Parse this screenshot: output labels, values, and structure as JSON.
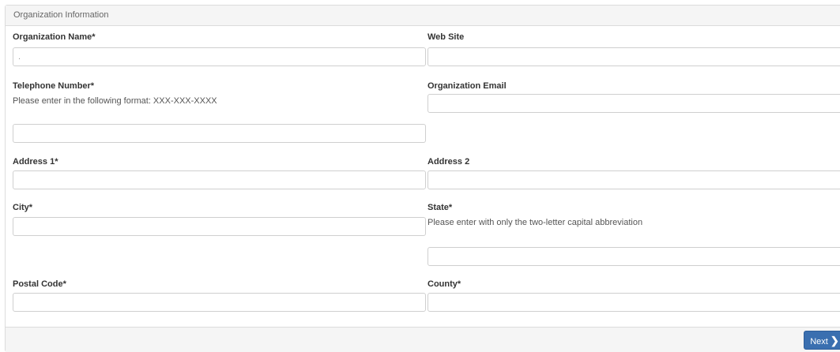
{
  "panel": {
    "title": "Organization Information"
  },
  "fields": {
    "org_name": {
      "label": "Organization Name*",
      "value": "."
    },
    "website": {
      "label": "Web Site",
      "value": ""
    },
    "telephone": {
      "label": "Telephone Number*",
      "help": "Please enter in the following format: XXX-XXX-XXXX",
      "value": ""
    },
    "org_email": {
      "label": "Organization Email",
      "value": ""
    },
    "address1": {
      "label": "Address 1*",
      "value": ""
    },
    "address2": {
      "label": "Address 2",
      "value": ""
    },
    "city": {
      "label": "City*",
      "value": ""
    },
    "state": {
      "label": "State*",
      "help": "Please enter with only the two-letter capital abbreviation",
      "value": ""
    },
    "postal_code": {
      "label": "Postal Code*",
      "value": ""
    },
    "county": {
      "label": "County*",
      "value": ""
    }
  },
  "footer": {
    "next_label": "Next",
    "next_icon": "chevron-right-icon"
  }
}
